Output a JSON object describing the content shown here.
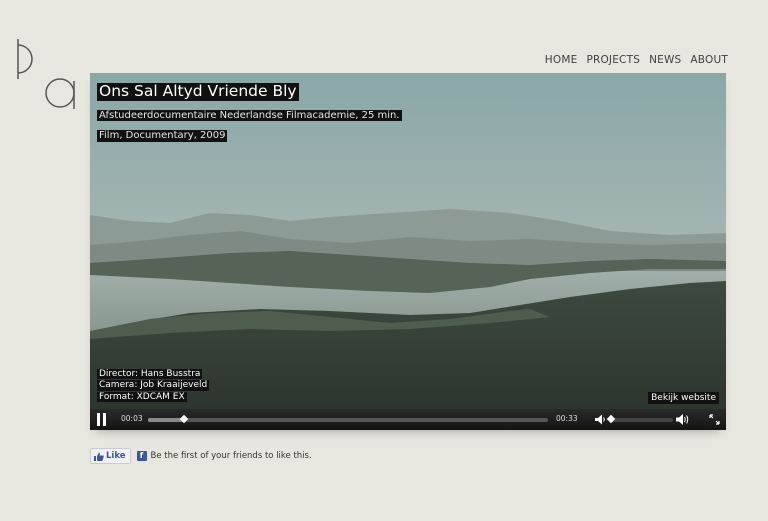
{
  "nav": [
    "HOME",
    "PROJECTS",
    "NEWS",
    "ABOUT"
  ],
  "video": {
    "title": "Ons Sal Altyd Vriende Bly",
    "subtitle_1": "Afstudeerdocumentaire Nederlandse Filmacademie, 25 min.",
    "subtitle_2": "Film, Documentary, 2009",
    "credits": [
      "Director: Hans Busstra",
      "Camera: Job Kraaijeveld",
      "Format: XDCAM EX"
    ],
    "website_button": "Bekijk website"
  },
  "player": {
    "current_time": "00:03",
    "duration": "00:33",
    "progress_fraction": 0.09,
    "volume_fraction": 0.03
  },
  "social": {
    "like_label": "Like",
    "like_text": "Be the first of your friends to like this."
  },
  "colors": {
    "background": "#e8e7df",
    "facebook": "#3b5998"
  }
}
